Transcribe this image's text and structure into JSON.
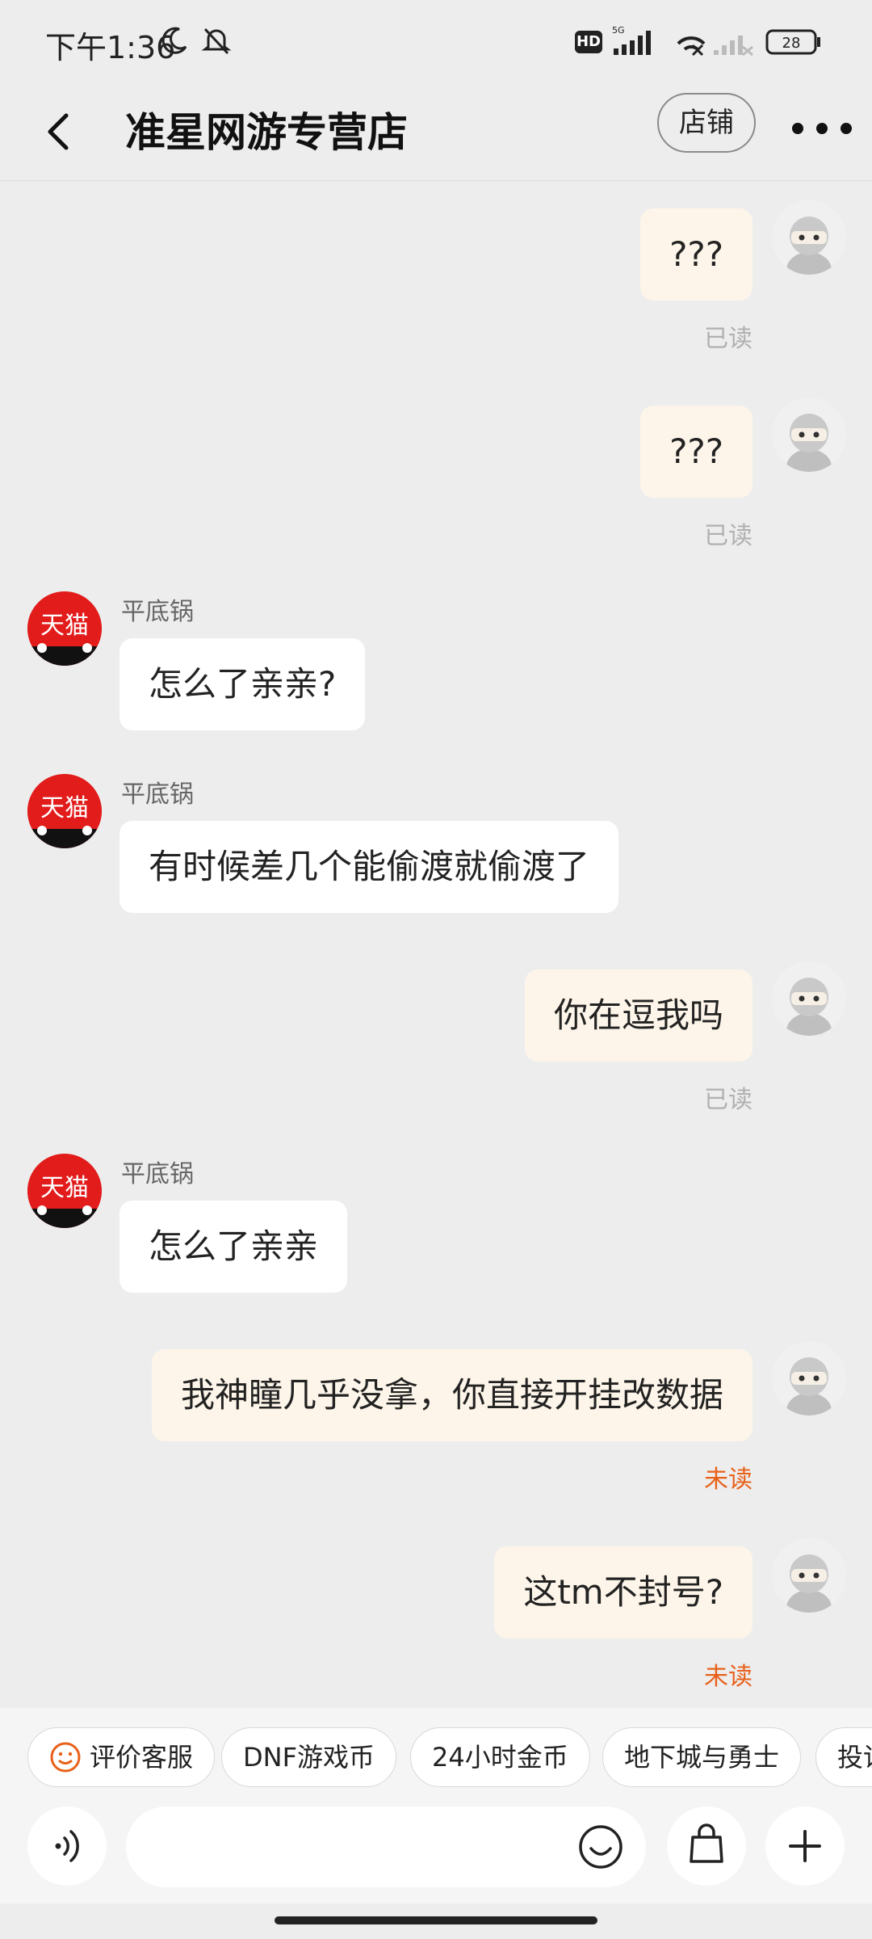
{
  "status_bar": {
    "time": "下午1:36",
    "hd": "HD",
    "network": "5G",
    "battery": "28"
  },
  "header": {
    "title": "准星网游专营店",
    "shop_label": "店铺"
  },
  "tmall_badge": "天猫",
  "messages": [
    {
      "side": "me",
      "text": "???",
      "status": "已读"
    },
    {
      "side": "me",
      "text": "???",
      "status": "已读"
    },
    {
      "side": "them",
      "sender": "平底锅",
      "text": "怎么了亲亲?"
    },
    {
      "side": "them",
      "sender": "平底锅",
      "text": "有时候差几个能偷渡就偷渡了"
    },
    {
      "side": "me",
      "text": "你在逗我吗",
      "status": "已读"
    },
    {
      "side": "them",
      "sender": "平底锅",
      "text": "怎么了亲亲"
    },
    {
      "side": "me",
      "text": "我神瞳几乎没拿，你直接开挂改数据",
      "status": "未读"
    },
    {
      "side": "me",
      "text": "这tm不封号?",
      "status": "未读"
    }
  ],
  "quick_replies": [
    "评价客服",
    "DNF游戏币",
    "24小时金币",
    "地下城与勇士",
    "投诉"
  ],
  "input": {
    "placeholder": ""
  },
  "colors": {
    "background": "#ededed",
    "my_bubble": "#fdf5e9",
    "their_bubble": "#ffffff",
    "unread": "#e8611a",
    "read": "#b0b0b0",
    "tmall_red": "#e21b1b"
  }
}
